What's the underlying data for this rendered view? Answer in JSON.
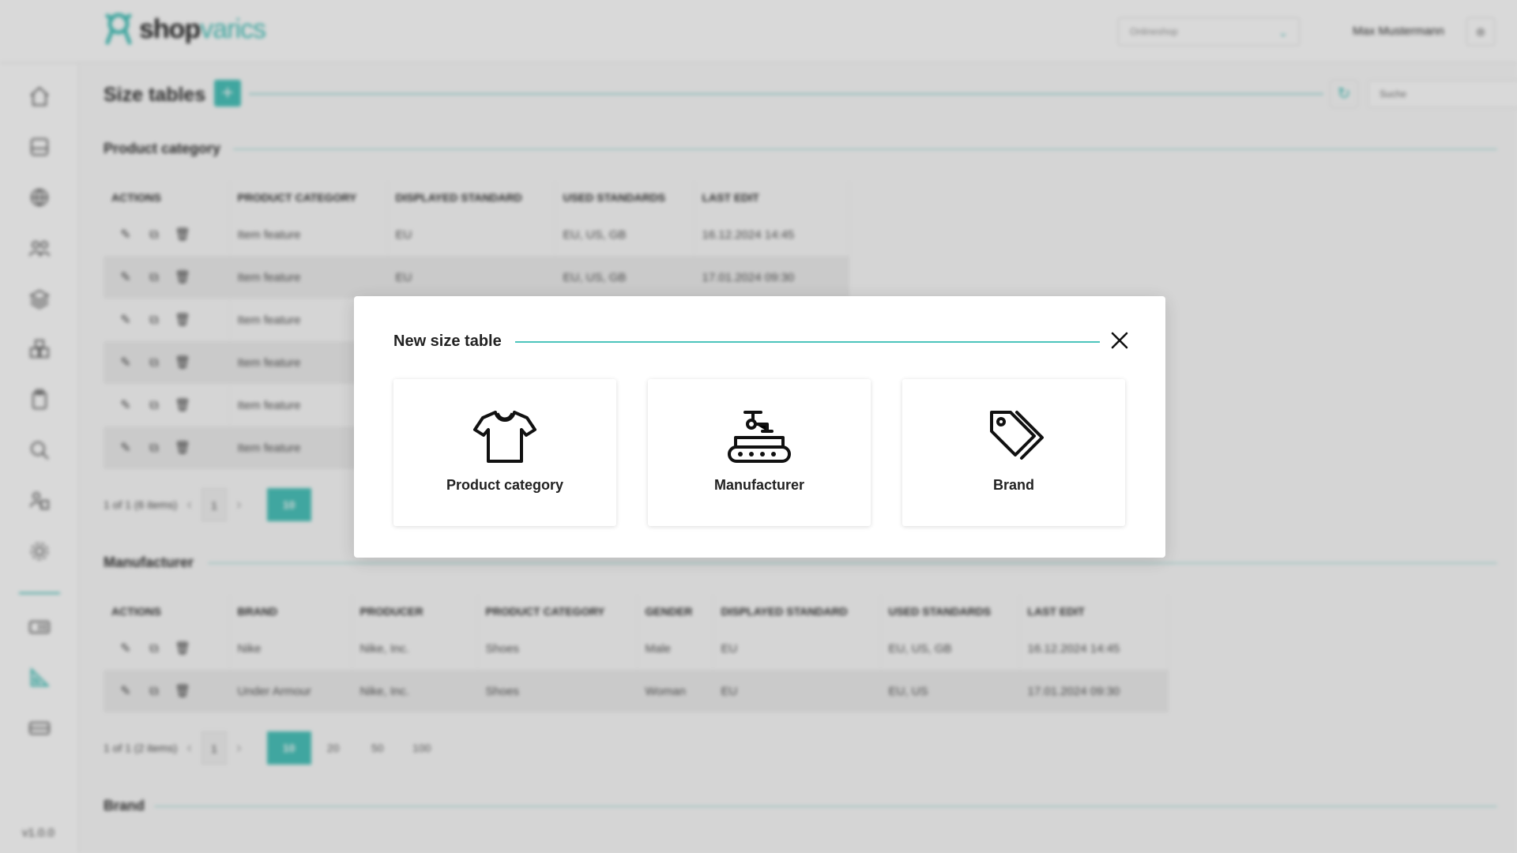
{
  "header": {
    "logo_prefix": "shop",
    "logo_suffix": "varics",
    "shop_select_value": "Onlineshop",
    "user_name": "Max Mustermann"
  },
  "sidebar": {
    "icons": [
      "home-icon",
      "box-icon",
      "globe-icon",
      "users-icon",
      "layers-icon",
      "boxes-icon",
      "clipboard-icon",
      "search-doc-icon",
      "people-box-icon",
      "gear-icon",
      "id-card-icon",
      "ruler-triangle-icon",
      "ticket-icon"
    ],
    "version": "v1.0.0"
  },
  "main": {
    "title": "Size tables",
    "add_label": "+",
    "search_placeholder": "Suche",
    "product_category": {
      "title": "Product category",
      "columns": [
        "ACTIONS",
        "PRODUCT CATEGORY",
        "DISPLAYED STANDARD",
        "USED STANDARDS",
        "LAST EDIT"
      ],
      "rows": [
        [
          "Item feature",
          "EU",
          "EU, US, GB",
          "16.12.2024 14:45"
        ],
        [
          "Item feature",
          "EU",
          "EU, US, GB",
          "17.01.2024 09:30"
        ],
        [
          "Item feature",
          "",
          "",
          ""
        ],
        [
          "Item feature",
          "",
          "",
          ""
        ],
        [
          "Item feature",
          "",
          "",
          ""
        ],
        [
          "Item feature",
          "",
          "",
          ""
        ]
      ],
      "pager_text": "1 of 1 (6 items)",
      "page": "1",
      "page_sizes": [
        "10"
      ]
    },
    "manufacturer": {
      "title": "Manufacturer",
      "columns": [
        "ACTIONS",
        "BRAND",
        "PRODUCER",
        "PRODUCT CATEGORY",
        "GENDER",
        "DISPLAYED STANDARD",
        "USED STANDARDS",
        "LAST EDIT"
      ],
      "rows": [
        [
          "Nike",
          "Nike, Inc.",
          "Shoes",
          "Male",
          "EU",
          "EU, US, GB",
          "16.12.2024 14:45"
        ],
        [
          "Under Armour",
          "Nike, Inc.",
          "Shoes",
          "Woman",
          "EU",
          "EU, US",
          "17.01.2024 09:30"
        ]
      ],
      "pager_text": "1 of 1 (2 items)",
      "page": "1",
      "page_sizes": [
        "10",
        "20",
        "50",
        "100"
      ]
    },
    "brand": {
      "title": "Brand"
    }
  },
  "modal": {
    "title": "New size table",
    "options": [
      {
        "label": "Product category",
        "icon": "tshirt-icon"
      },
      {
        "label": "Manufacturer",
        "icon": "factory-conveyor-icon"
      },
      {
        "label": "Brand",
        "icon": "price-tags-icon"
      }
    ]
  },
  "colors": {
    "accent": "#4cc4bc",
    "text": "#222222"
  }
}
